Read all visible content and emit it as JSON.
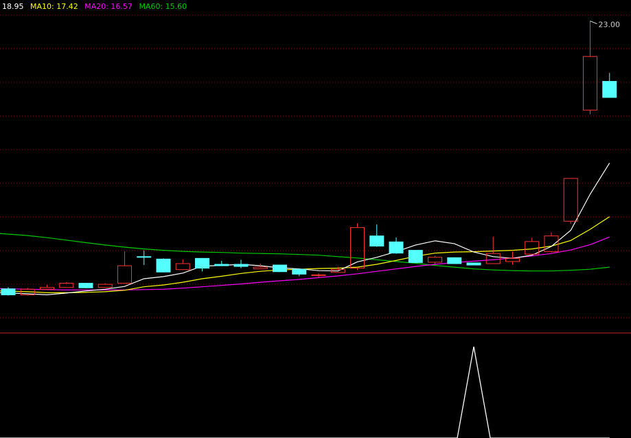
{
  "legend": {
    "ma5": "18.95",
    "ma10": "MA10: 17.42",
    "ma20": "MA20: 16.57",
    "ma60": "MA60: 15.60"
  },
  "colors": {
    "background": "#000000",
    "up": "#ff3232",
    "down": "#54ffff",
    "ma5": "#ffffff",
    "ma10": "#ffff00",
    "ma20": "#ff00ff",
    "ma60": "#00cc00",
    "grid": "#8a1010",
    "divider": "#c82828"
  },
  "chart_data": {
    "type": "candlestick",
    "ylim": [
      14.2,
      23.6
    ],
    "max_annotation": "23.00",
    "candles": [
      {
        "o": 15.36,
        "h": 15.41,
        "l": 15.17,
        "c": 15.19
      },
      {
        "o": 15.19,
        "h": 15.39,
        "l": 15.17,
        "c": 15.35
      },
      {
        "o": 15.35,
        "h": 15.47,
        "l": 15.34,
        "c": 15.4
      },
      {
        "o": 15.4,
        "h": 15.55,
        "l": 15.4,
        "c": 15.52
      },
      {
        "o": 15.52,
        "h": 15.53,
        "l": 15.38,
        "c": 15.39
      },
      {
        "o": 15.4,
        "h": 15.52,
        "l": 15.39,
        "c": 15.49
      },
      {
        "o": 15.52,
        "h": 16.43,
        "l": 15.52,
        "c": 16.02
      },
      {
        "o": 16.28,
        "h": 16.46,
        "l": 16.04,
        "c": 16.26
      },
      {
        "o": 16.21,
        "h": 16.23,
        "l": 15.83,
        "c": 15.84
      },
      {
        "o": 15.91,
        "h": 16.2,
        "l": 15.91,
        "c": 16.08
      },
      {
        "o": 16.23,
        "h": 16.24,
        "l": 15.86,
        "c": 15.95
      },
      {
        "o": 16.06,
        "h": 16.16,
        "l": 16.01,
        "c": 16.02
      },
      {
        "o": 16.06,
        "h": 16.19,
        "l": 15.95,
        "c": 16.0
      },
      {
        "o": 15.93,
        "h": 16.08,
        "l": 15.93,
        "c": 15.98
      },
      {
        "o": 16.04,
        "h": 16.05,
        "l": 15.84,
        "c": 15.85
      },
      {
        "o": 15.92,
        "h": 15.93,
        "l": 15.72,
        "c": 15.78
      },
      {
        "o": 15.75,
        "h": 15.8,
        "l": 15.69,
        "c": 15.76
      },
      {
        "o": 15.83,
        "h": 15.99,
        "l": 15.82,
        "c": 15.91
      },
      {
        "o": 15.95,
        "h": 17.23,
        "l": 15.9,
        "c": 17.11
      },
      {
        "o": 16.87,
        "h": 17.2,
        "l": 16.56,
        "c": 16.58
      },
      {
        "o": 16.7,
        "h": 16.83,
        "l": 16.36,
        "c": 16.38
      },
      {
        "o": 16.46,
        "h": 16.46,
        "l": 16.1,
        "c": 16.11
      },
      {
        "o": 16.12,
        "h": 16.3,
        "l": 16.07,
        "c": 16.26
      },
      {
        "o": 16.25,
        "h": 16.26,
        "l": 16.07,
        "c": 16.08
      },
      {
        "o": 16.1,
        "h": 16.11,
        "l": 16.03,
        "c": 16.04
      },
      {
        "o": 16.08,
        "h": 16.85,
        "l": 16.07,
        "c": 16.37
      },
      {
        "o": 16.14,
        "h": 16.42,
        "l": 16.05,
        "c": 16.23
      },
      {
        "o": 16.35,
        "h": 16.82,
        "l": 16.34,
        "c": 16.71
      },
      {
        "o": 16.42,
        "h": 16.97,
        "l": 16.4,
        "c": 16.87
      },
      {
        "o": 17.29,
        "h": 18.51,
        "l": 17.21,
        "c": 18.51
      },
      {
        "o": 20.46,
        "h": 23.0,
        "l": 20.34,
        "c": 21.99
      },
      {
        "o": 21.28,
        "h": 21.52,
        "l": 20.82,
        "c": 20.82
      }
    ],
    "ma5": [
      15.25,
      15.22,
      15.19,
      15.24,
      15.3,
      15.35,
      15.43,
      15.65,
      15.71,
      15.81,
      16.01,
      16.03,
      16.06,
      16.02,
      15.96,
      15.93,
      15.88,
      15.87,
      16.13,
      16.26,
      16.42,
      16.61,
      16.73,
      16.65,
      16.41,
      16.28,
      16.23,
      16.32,
      16.57,
      17.03,
      18.06,
      18.95
    ],
    "ma10": [
      15.3,
      15.28,
      15.25,
      15.25,
      15.26,
      15.28,
      15.32,
      15.42,
      15.47,
      15.55,
      15.65,
      15.72,
      15.8,
      15.86,
      15.9,
      15.92,
      15.94,
      15.95,
      15.98,
      16.06,
      16.17,
      16.29,
      16.38,
      16.41,
      16.42,
      16.44,
      16.46,
      16.5,
      16.58,
      16.74,
      17.06,
      17.42
    ],
    "ma20": [
      15.37,
      15.35,
      15.34,
      15.33,
      15.33,
      15.33,
      15.33,
      15.34,
      15.35,
      15.38,
      15.42,
      15.46,
      15.5,
      15.55,
      15.59,
      15.63,
      15.68,
      15.73,
      15.79,
      15.86,
      15.93,
      16.0,
      16.06,
      16.11,
      16.15,
      16.19,
      16.24,
      16.3,
      16.37,
      16.47,
      16.62,
      16.84
    ],
    "ma60": [
      16.94,
      16.88,
      16.82,
      16.75,
      16.68,
      16.61,
      16.55,
      16.5,
      16.46,
      16.43,
      16.41,
      16.4,
      16.38,
      16.37,
      16.36,
      16.34,
      16.32,
      16.28,
      16.24,
      16.19,
      16.14,
      16.09,
      16.03,
      15.98,
      15.93,
      15.9,
      15.88,
      15.87,
      15.87,
      15.89,
      15.92,
      15.98
    ],
    "indicator": [
      0,
      0,
      0,
      0,
      0,
      0,
      0,
      0,
      0,
      0,
      0,
      0,
      0,
      0,
      0,
      0,
      0,
      0,
      0,
      0,
      0,
      0,
      0,
      0,
      1,
      0,
      0,
      0,
      0,
      0,
      0,
      0
    ]
  }
}
